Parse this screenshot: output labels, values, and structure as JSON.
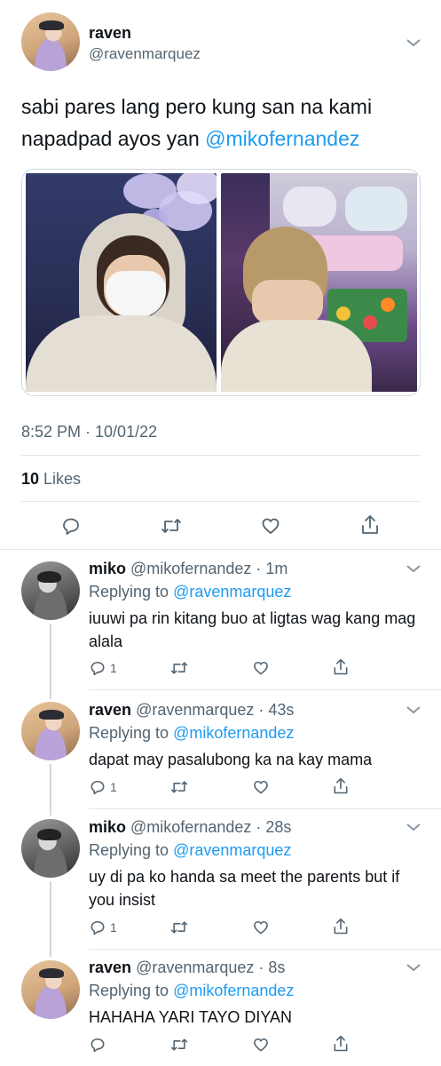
{
  "main_tweet": {
    "display_name": "raven",
    "handle": "@ravenmarquez",
    "text_before": "sabi pares lang pero kung san na kami napadpad ayos yan ",
    "mention": "@mikofernandez",
    "timestamp": "8:52 PM · 10/01/22",
    "likes_count": "10",
    "likes_label": " Likes"
  },
  "icons": {
    "reply": "reply-icon",
    "retweet": "retweet-icon",
    "like": "heart-icon",
    "share": "share-icon",
    "more": "chevron-down-icon"
  },
  "colors": {
    "accent": "#1d9bf0",
    "text": "#0f1419",
    "secondary": "#536471",
    "divider": "#e1e8ed"
  },
  "replies": [
    {
      "display_name": "miko",
      "meta": "@mikofernandez · 1m",
      "replying_label": "Replying to ",
      "replying_to": "@ravenmarquez",
      "text": "iuuwi pa rin kitang buo at ligtas wag kang mag alala",
      "reply_count": "1"
    },
    {
      "display_name": "raven",
      "meta": "@ravenmarquez · 43s",
      "replying_label": "Replying to ",
      "replying_to": "@mikofernandez",
      "text": "dapat may pasalubong ka na kay mama",
      "reply_count": "1"
    },
    {
      "display_name": "miko",
      "meta": "@mikofernandez · 28s",
      "replying_label": "Replying to ",
      "replying_to": "@ravenmarquez",
      "text": "uy di pa ko handa sa meet the parents but if you insist",
      "reply_count": "1"
    },
    {
      "display_name": "raven",
      "meta": "@ravenmarquez · 8s",
      "replying_label": "Replying to ",
      "replying_to": "@mikofernandez",
      "text": "HAHAHA YARI TAYO DIYAN",
      "reply_count": ""
    }
  ]
}
